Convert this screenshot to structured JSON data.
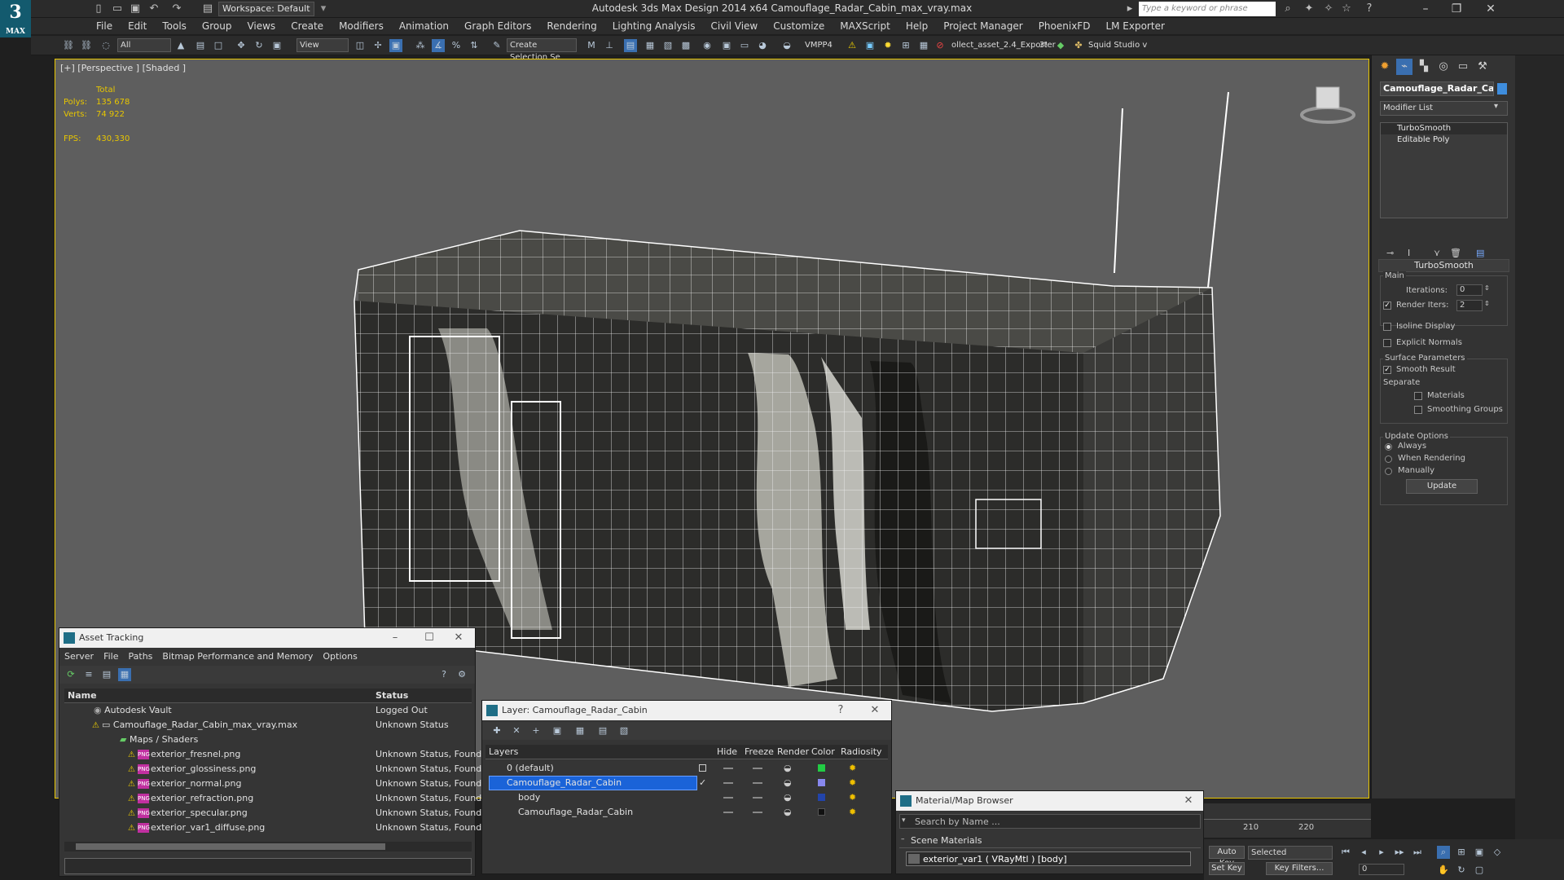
{
  "app": {
    "title": "Autodesk 3ds Max Design 2014 x64     Camouflage_Radar_Cabin_max_vray.max",
    "workspace": "Workspace: Default",
    "search_placeholder": "Type a keyword or phrase",
    "logo": "MAX"
  },
  "menu": [
    "File",
    "Edit",
    "Tools",
    "Group",
    "Views",
    "Create",
    "Modifiers",
    "Animation",
    "Graph Editors",
    "Rendering",
    "Lighting Analysis",
    "Civil View",
    "Customize",
    "MAXScript",
    "Help",
    "Project Manager",
    "PhoenixFD",
    "LM Exporter"
  ],
  "toolbar": {
    "filter": "All",
    "ref_coord": "View",
    "selection_set": "Create Selection Se",
    "vmpp": "VMPP4",
    "exporter": "ollect_asset_2.4_Exporter",
    "exporter_suffix": "3!",
    "squid": "Squid Studio v"
  },
  "viewport": {
    "label": "[+] [Perspective ] [Shaded ]",
    "stats_header": "Total",
    "polys_label": "Polys:",
    "polys_value": "135 678",
    "verts_label": "Verts:",
    "verts_value": "74 922",
    "fps_label": "FPS:",
    "fps_value": "430,330"
  },
  "command_panel": {
    "object_name": "Camouflage_Radar_Cabin",
    "modifier_list": "Modifier List",
    "stack": [
      "TurboSmooth",
      "Editable Poly"
    ],
    "rollout_title": "TurboSmooth",
    "main_group": "Main",
    "iterations_label": "Iterations:",
    "iterations_value": "0",
    "render_iters_label": "Render Iters:",
    "render_iters_value": "2",
    "isoline": "Isoline Display",
    "explicit_normals": "Explicit Normals",
    "surface_group": "Surface Parameters",
    "smooth_result": "Smooth Result",
    "separate": "Separate",
    "materials": "Materials",
    "smoothing_groups": "Smoothing Groups",
    "update_group": "Update Options",
    "always": "Always",
    "when_rendering": "When Rendering",
    "manually": "Manually",
    "update_button": "Update"
  },
  "asset_tracking": {
    "title": "Asset Tracking",
    "menu": [
      "Server",
      "File",
      "Paths",
      "Bitmap Performance and Memory",
      "Options"
    ],
    "columns": [
      "Name",
      "Status"
    ],
    "rows": [
      {
        "name": "Autodesk Vault",
        "status": "Logged Out",
        "indent": 0
      },
      {
        "name": "Camouflage_Radar_Cabin_max_vray.max",
        "status": "Unknown Status",
        "indent": 1
      },
      {
        "name": "Maps / Shaders",
        "status": "",
        "indent": 2
      },
      {
        "name": "exterior_fresnel.png",
        "status": "Unknown Status, Found",
        "indent": 3
      },
      {
        "name": "exterior_glossiness.png",
        "status": "Unknown Status, Found",
        "indent": 3
      },
      {
        "name": "exterior_normal.png",
        "status": "Unknown Status, Found",
        "indent": 3
      },
      {
        "name": "exterior_refraction.png",
        "status": "Unknown Status, Found",
        "indent": 3
      },
      {
        "name": "exterior_specular.png",
        "status": "Unknown Status, Found",
        "indent": 3
      },
      {
        "name": "exterior_var1_diffuse.png",
        "status": "Unknown Status, Found",
        "indent": 3
      }
    ]
  },
  "layer_window": {
    "title": "Layer: Camouflage_Radar_Cabin",
    "help": "?",
    "columns": [
      "Layers",
      "Hide",
      "Freeze",
      "Render",
      "Color",
      "Radiosity"
    ],
    "rows": [
      {
        "name": "0 (default)",
        "color": "#22cc44",
        "selected": false
      },
      {
        "name": "Camouflage_Radar_Cabin",
        "color": "#8888ee",
        "selected": true
      },
      {
        "name": "body",
        "color": "#2244aa",
        "selected": false
      },
      {
        "name": "Camouflage_Radar_Cabin",
        "color": "#111111",
        "selected": false
      }
    ]
  },
  "material_browser": {
    "title": "Material/Map Browser",
    "search_placeholder": "Search by Name ...",
    "section": "Scene Materials",
    "item": "exterior_var1  ( VRayMtl )  [body]"
  },
  "timeline": {
    "tick_210": "210",
    "tick_220": "220",
    "auto_key": "Auto Key",
    "selected": "Selected",
    "set_key": "Set Key",
    "key_filters": "Key Filters...",
    "frame": "0"
  },
  "colors": {
    "accent": "#e8c600",
    "selection": "#1a63d8",
    "viewport_bg": "#5e5e5e"
  }
}
